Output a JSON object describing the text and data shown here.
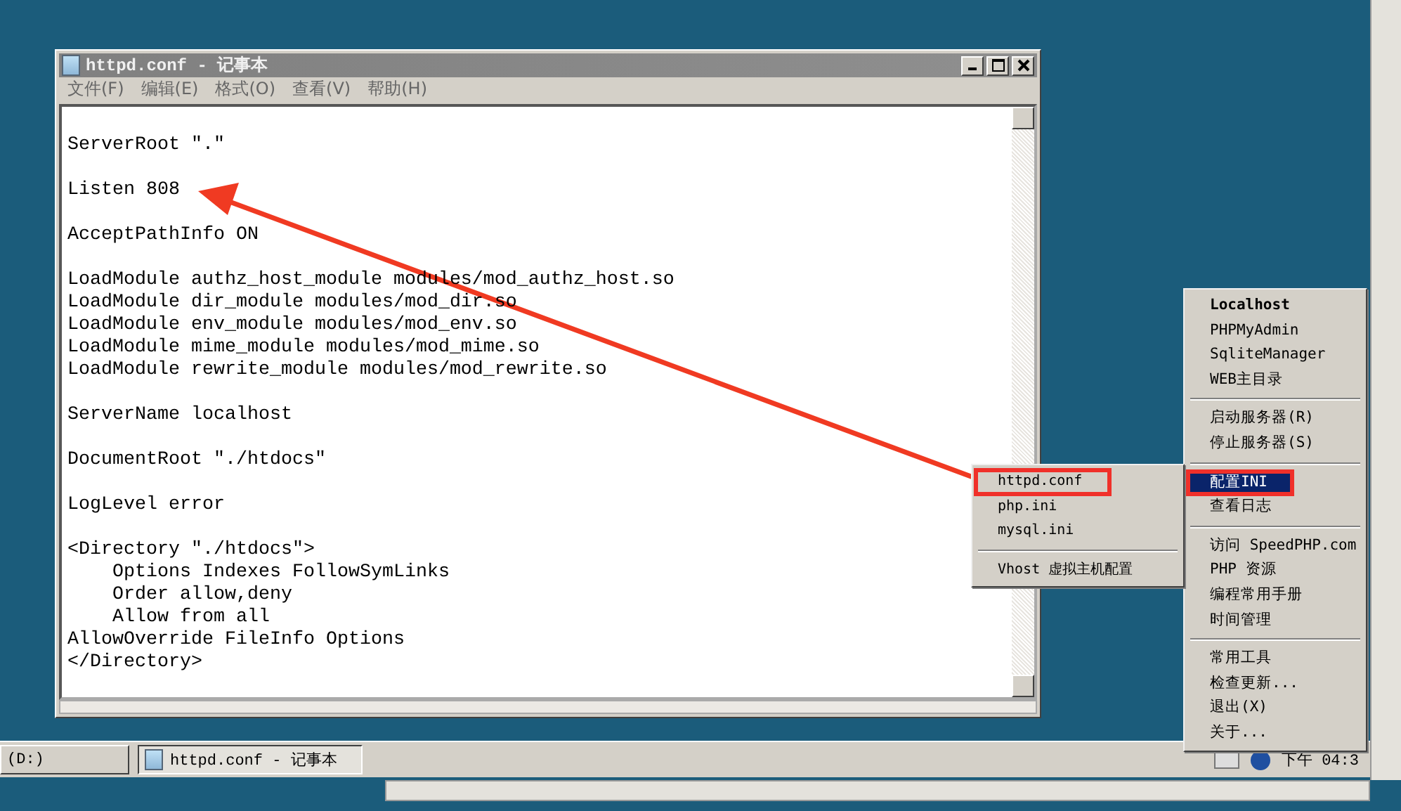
{
  "window": {
    "title": "httpd.conf - 记事本",
    "menu": [
      "文件(F)",
      "编辑(E)",
      "格式(O)",
      "查看(V)",
      "帮助(H)"
    ]
  },
  "document": {
    "blocks": [
      [
        "ServerRoot \".\""
      ],
      [
        "Listen 808"
      ],
      [
        "AcceptPathInfo ON"
      ],
      [
        "LoadModule authz_host_module modules/mod_authz_host.so",
        "LoadModule dir_module modules/mod_dir.so",
        "LoadModule env_module modules/mod_env.so",
        "LoadModule mime_module modules/mod_mime.so",
        "LoadModule rewrite_module modules/mod_rewrite.so"
      ],
      [
        "ServerName localhost"
      ],
      [
        "DocumentRoot \"./htdocs\""
      ],
      [
        "LogLevel error"
      ],
      [
        "<Directory \"./htdocs\">",
        "    Options Indexes FollowSymLinks",
        "    Order allow,deny",
        "    Allow from all",
        "AllowOverride FileInfo Options",
        "</Directory>"
      ]
    ]
  },
  "tray_menu": {
    "items": [
      {
        "kind": "header",
        "label": "Localhost",
        "selected": false,
        "highlighted": false
      },
      {
        "kind": "item",
        "label": "PHPMyAdmin",
        "selected": false,
        "highlighted": false
      },
      {
        "kind": "item",
        "label": "SqliteManager",
        "selected": false,
        "highlighted": false
      },
      {
        "kind": "item",
        "label": "WEB主目录",
        "selected": false,
        "highlighted": false
      },
      {
        "kind": "separator"
      },
      {
        "kind": "item",
        "label": "启动服务器(R)",
        "selected": false,
        "highlighted": false
      },
      {
        "kind": "item",
        "label": "停止服务器(S)",
        "selected": false,
        "highlighted": false
      },
      {
        "kind": "separator"
      },
      {
        "kind": "item",
        "label": "配置INI",
        "selected": true,
        "highlighted": true
      },
      {
        "kind": "item",
        "label": "查看日志",
        "selected": false,
        "highlighted": false
      },
      {
        "kind": "separator"
      },
      {
        "kind": "item",
        "label": "访问 SpeedPHP.com",
        "selected": false,
        "highlighted": false
      },
      {
        "kind": "item",
        "label": "PHP 资源",
        "selected": false,
        "highlighted": false
      },
      {
        "kind": "item",
        "label": "编程常用手册",
        "selected": false,
        "highlighted": false
      },
      {
        "kind": "item",
        "label": "时间管理",
        "selected": false,
        "highlighted": false
      },
      {
        "kind": "separator"
      },
      {
        "kind": "item",
        "label": "常用工具",
        "selected": false,
        "highlighted": false
      },
      {
        "kind": "item",
        "label": "检查更新...",
        "selected": false,
        "highlighted": false
      },
      {
        "kind": "item",
        "label": "退出(X)",
        "selected": false,
        "highlighted": false
      },
      {
        "kind": "item",
        "label": "关于...",
        "selected": false,
        "highlighted": false
      }
    ]
  },
  "submenu": {
    "items": [
      {
        "kind": "item",
        "label": "httpd.conf",
        "selected": false,
        "highlighted": true
      },
      {
        "kind": "item",
        "label": "php.ini",
        "selected": false,
        "highlighted": false
      },
      {
        "kind": "item",
        "label": "mysql.ini",
        "selected": false,
        "highlighted": false
      },
      {
        "kind": "separator"
      },
      {
        "kind": "item",
        "label": "Vhost 虚拟主机配置",
        "selected": false,
        "highlighted": false
      }
    ]
  },
  "taskbar": {
    "buttons": [
      {
        "label": "(D:)",
        "selected": false
      },
      {
        "label": "httpd.conf - 记事本",
        "selected": true
      }
    ],
    "clock": "下午 04:3"
  }
}
